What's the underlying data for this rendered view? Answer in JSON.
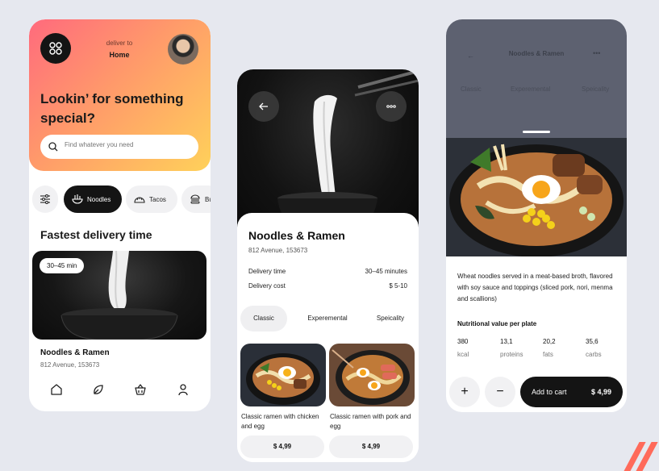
{
  "home": {
    "deliver_to_label": "deliver to",
    "deliver_to_value": "Home",
    "headline": "Lookin’ for something special?",
    "search_placeholder": "Find whatever you need",
    "categories": [
      {
        "label": "",
        "icon": "filter-icon",
        "active": false
      },
      {
        "label": "Noodles",
        "icon": "noodle-bowl-icon",
        "active": true
      },
      {
        "label": "Tacos",
        "icon": "taco-icon",
        "active": false
      },
      {
        "label": "Bu",
        "icon": "burger-icon",
        "active": false
      }
    ],
    "section_title": "Fastest delivery time",
    "featured": {
      "time_badge": "30–45 min",
      "title": "Noodles & Ramen",
      "address": "812 Avenue, 153673"
    },
    "nav_icons": [
      "home-icon",
      "leaf-icon",
      "basket-icon",
      "profile-icon"
    ]
  },
  "restaurant": {
    "title": "Noodles & Ramen",
    "address": "812 Avenue, 153673",
    "delivery_time_label": "Delivery time",
    "delivery_time_value": "30–45 minutes",
    "delivery_cost_label": "Delivery cost",
    "delivery_cost_value": "$ 5-10",
    "tabs": [
      "Classic",
      "Experemental",
      "Speicality"
    ],
    "active_tab": "Classic",
    "items": [
      {
        "name": "Classic ramen with chicken and egg",
        "price": "$ 4,99"
      },
      {
        "name": "Classic ramen with pork and egg",
        "price": "$ 4,99"
      }
    ]
  },
  "detail": {
    "header_title": "Noodles & Ramen",
    "tabs": [
      "Classic",
      "Experemental",
      "Speicality"
    ],
    "description": "Wheat noodles served in a meat-based broth, flavored with soy sauce and toppings (sliced pork, nori, menma and scallions)",
    "nutrition_title": "Nutritional value per plate",
    "nutrition": [
      {
        "value": "380",
        "unit": "kcal"
      },
      {
        "value": "13,1",
        "unit": "proteins"
      },
      {
        "value": "20,2",
        "unit": "fats"
      },
      {
        "value": "35,6",
        "unit": "carbs"
      }
    ],
    "plus": "+",
    "minus": "−",
    "add_to_cart_label": "Add to cart",
    "price": "$ 4,99"
  },
  "colors": {
    "gradient_start": "#ff6a7d",
    "gradient_end": "#ffd15a",
    "dark": "#141414",
    "chip_bg": "#f1f1f3",
    "page_bg": "#e6e8ef"
  }
}
